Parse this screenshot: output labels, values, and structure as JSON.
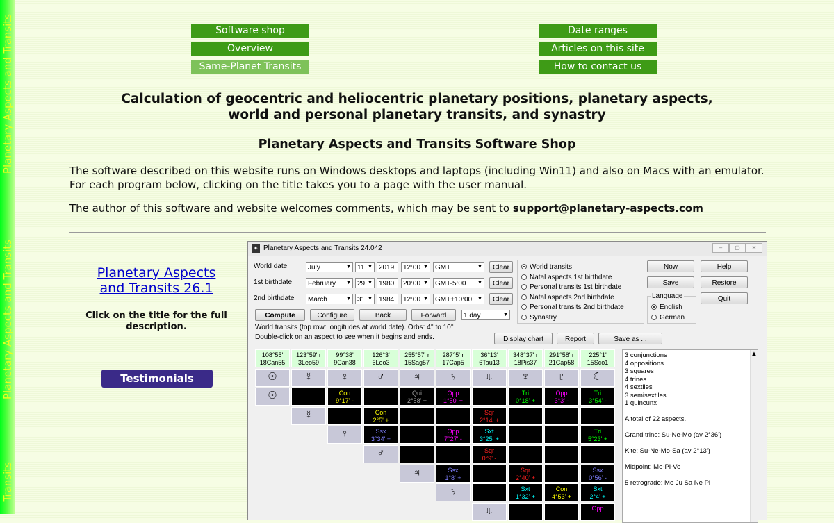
{
  "side_text": [
    "Planetary Aspects and Transits",
    "Planetary Aspects and Transits",
    "Transits"
  ],
  "nav": {
    "left": [
      "Software shop",
      "Overview",
      "Same-Planet Transits"
    ],
    "right": [
      "Date ranges",
      "Articles on this site",
      "How to contact us"
    ]
  },
  "headline": {
    "line1": "Calculation of geocentric and heliocentric planetary positions, planetary aspects,",
    "line2": "world and personal planetary transits, and synastry",
    "subtitle": "Planetary Aspects and Transits Software Shop"
  },
  "intro": {
    "line1": "The software described on this website runs on Windows desktops and laptops (including Win11) and also on Macs with an emulator.",
    "line2": "For each program below, clicking on the title takes you to a page with the user manual.",
    "contact_prefix": "The author of this software and website welcomes comments, which may be sent to ",
    "email": "support@planetary-aspects.com"
  },
  "product": {
    "title_line1": "Planetary Aspects",
    "title_line2": "and Transits 26.1",
    "note": "Click on the title for the full description.",
    "testimonials": "Testimonials"
  },
  "app": {
    "title": "Planetary Aspects and Transits 24.042",
    "rows": [
      {
        "label": "World date",
        "month": "July",
        "day": "11",
        "year": "2019",
        "time": "12:00",
        "zone": "GMT",
        "clear": "Clear"
      },
      {
        "label": "1st birthdate",
        "month": "February",
        "day": "29",
        "year": "1980",
        "time": "20:00",
        "zone": "GMT-5:00",
        "clear": "Clear"
      },
      {
        "label": "2nd birthdate",
        "month": "March",
        "day": "31",
        "year": "1984",
        "time": "12:00",
        "zone": "GMT+10:00",
        "clear": "Clear"
      }
    ],
    "buttons": {
      "compute": "Compute",
      "configure": "Configure",
      "back": "Back",
      "forward": "Forward",
      "step": "1 day",
      "now": "Now",
      "help": "Help",
      "save": "Save",
      "restore": "Restore",
      "quit": "Quit",
      "display_chart": "Display chart",
      "report": "Report",
      "save_as": "Save as ..."
    },
    "modes": [
      "World transits",
      "Natal aspects 1st birthdate",
      "Personal transits 1st birthdate",
      "Natal aspects 2nd birthdate",
      "Personal transits 2nd birthdate",
      "Synastry"
    ],
    "language": {
      "label": "Language",
      "options": [
        "English",
        "German"
      ]
    },
    "info1": "World transits (top row: longitudes at world date).  Orbs: 4° to 10°",
    "info2": "Double-click on an aspect to see when it begins and ends.",
    "headers": [
      [
        "108°55'",
        "18Can55"
      ],
      [
        "123°59' r",
        "3Leo59"
      ],
      [
        "99°38'",
        "9Can38"
      ],
      [
        "126°3'",
        "6Leo3"
      ],
      [
        "255°57' r",
        "15Sag57"
      ],
      [
        "287°5' r",
        "17Cap5"
      ],
      [
        "36°13'",
        "6Tau13"
      ],
      [
        "348°37' r",
        "18Pis37"
      ],
      [
        "291°58' r",
        "21Cap58"
      ],
      [
        "225°1'",
        "15Sco1"
      ]
    ],
    "symbols": [
      "☉",
      "☿",
      "♀",
      "♂",
      "♃",
      "♄",
      "♅",
      "♆",
      "♇",
      "☾"
    ],
    "aspect_rows": [
      [
        null,
        {
          "n": "Con",
          "v": "9°17' -",
          "c": "#ffff00"
        },
        null,
        {
          "n": "Qui",
          "v": "2°58' +",
          "c": "#a0a0a0"
        },
        {
          "n": "Opp",
          "v": "1°50' +",
          "c": "#ff00ff"
        },
        null,
        {
          "n": "Tri",
          "v": "0°18' +",
          "c": "#00ff00"
        },
        {
          "n": "Opp",
          "v": "3°3' -",
          "c": "#ff00ff"
        },
        {
          "n": "Tri",
          "v": "3°54' -",
          "c": "#00ff00"
        }
      ],
      [
        null,
        {
          "n": "Con",
          "v": "2°5' +",
          "c": "#ffff00"
        },
        null,
        null,
        {
          "n": "Sqr",
          "v": "2°14' +",
          "c": "#ff2020"
        },
        null,
        null,
        null
      ],
      [
        {
          "n": "Ssx",
          "v": "3°34' +",
          "c": "#8080ff"
        },
        null,
        {
          "n": "Opp",
          "v": "7°27' -",
          "c": "#ff00ff"
        },
        {
          "n": "Sxt",
          "v": "3°25' +",
          "c": "#00ffff"
        },
        null,
        null,
        {
          "n": "Tri",
          "v": "5°23' +",
          "c": "#00ff00"
        }
      ],
      [
        null,
        null,
        {
          "n": "Sqr",
          "v": "0°9' -",
          "c": "#ff2020"
        },
        null,
        null,
        null
      ],
      [
        {
          "n": "Ssx",
          "v": "1°8' +",
          "c": "#8080ff"
        },
        null,
        {
          "n": "Sqr",
          "v": "2°40' +",
          "c": "#ff2020"
        },
        null,
        {
          "n": "Ssx",
          "v": "0°56' -",
          "c": "#8080ff"
        }
      ],
      [
        null,
        {
          "n": "Sxt",
          "v": "1°32' +",
          "c": "#00ffff"
        },
        {
          "n": "Con",
          "v": "4°53' +",
          "c": "#ffff00"
        },
        {
          "n": "Sxt",
          "v": "2°4' +",
          "c": "#00ffff"
        }
      ],
      [
        null,
        null,
        {
          "n": "Opp",
          "v": "",
          "c": "#ff00ff"
        }
      ]
    ],
    "summary": [
      "3 conjunctions",
      "4 oppositions",
      "3 squares",
      "4 trines",
      "4 sextiles",
      "3 semisextiles",
      "1 quincunx",
      "",
      "A total of 22 aspects.",
      "",
      "Grand trine: Su-Ne-Mo (av 2°36')",
      "",
      "Kite: Su-Ne-Mo-Sa (av 2°13')",
      "",
      "Midpoint: Me-Pl-Ve",
      "",
      "5 retrograde: Me Ju Sa Ne Pl"
    ],
    "colors": {
      "header_bg": "#d8ffd8",
      "symbol_bg": "#c8c8d8",
      "cell_bg": "#000000"
    }
  },
  "colors": {
    "nav_green": "#3e9b16",
    "nav_active": "#7ec25a",
    "link_blue": "#0000cc",
    "testimonials_bg": "#3a2a88"
  }
}
